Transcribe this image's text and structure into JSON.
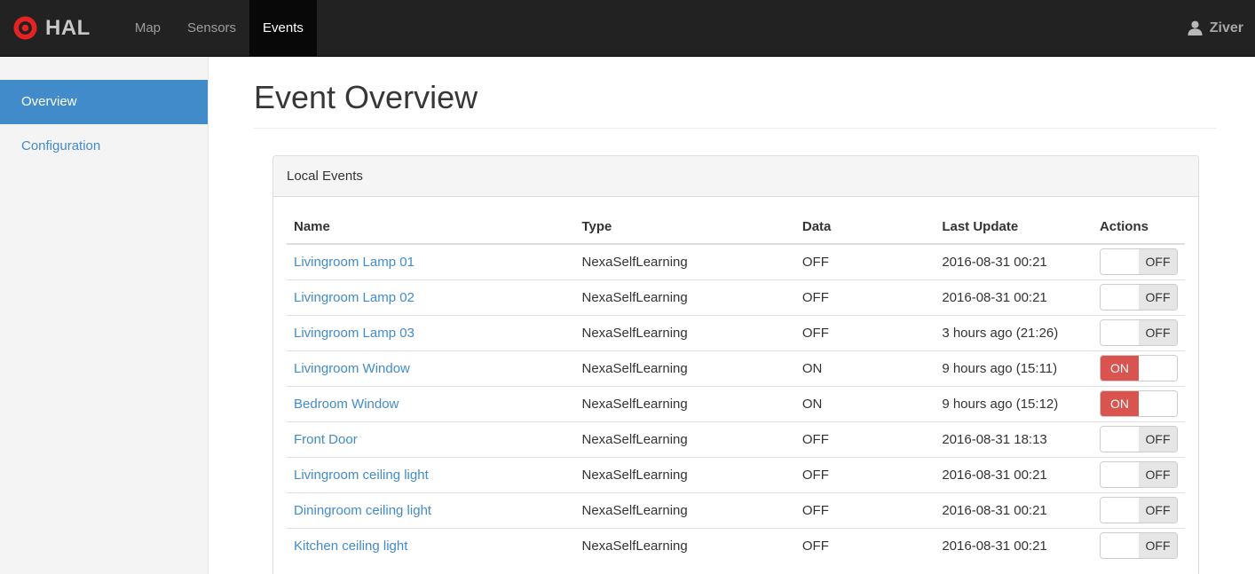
{
  "navbar": {
    "brand": "HAL",
    "items": [
      {
        "label": "Map",
        "active": false
      },
      {
        "label": "Sensors",
        "active": false
      },
      {
        "label": "Events",
        "active": true
      }
    ],
    "user": "Ziver"
  },
  "sidebar": {
    "items": [
      {
        "label": "Overview",
        "active": true
      },
      {
        "label": "Configuration",
        "active": false
      }
    ]
  },
  "page": {
    "title": "Event Overview"
  },
  "panel": {
    "title": "Local Events"
  },
  "toggle": {
    "on_label": "ON",
    "off_label": "OFF"
  },
  "table": {
    "columns": [
      "Name",
      "Type",
      "Data",
      "Last Update",
      "Actions"
    ],
    "rows": [
      {
        "name": "Livingroom Lamp 01",
        "type": "NexaSelfLearning",
        "data": "OFF",
        "last_update": "2016-08-31 00:21",
        "state": "OFF"
      },
      {
        "name": "Livingroom Lamp 02",
        "type": "NexaSelfLearning",
        "data": "OFF",
        "last_update": "2016-08-31 00:21",
        "state": "OFF"
      },
      {
        "name": "Livingroom Lamp 03",
        "type": "NexaSelfLearning",
        "data": "OFF",
        "last_update": "3 hours ago (21:26)",
        "state": "OFF"
      },
      {
        "name": "Livingroom Window",
        "type": "NexaSelfLearning",
        "data": "ON",
        "last_update": "9 hours ago (15:11)",
        "state": "ON"
      },
      {
        "name": "Bedroom Window",
        "type": "NexaSelfLearning",
        "data": "ON",
        "last_update": "9 hours ago (15:12)",
        "state": "ON"
      },
      {
        "name": "Front Door",
        "type": "NexaSelfLearning",
        "data": "OFF",
        "last_update": "2016-08-31 18:13",
        "state": "OFF"
      },
      {
        "name": "Livingroom ceiling light",
        "type": "NexaSelfLearning",
        "data": "OFF",
        "last_update": "2016-08-31 00:21",
        "state": "OFF"
      },
      {
        "name": "Diningroom ceiling light",
        "type": "NexaSelfLearning",
        "data": "OFF",
        "last_update": "2016-08-31 00:21",
        "state": "OFF"
      },
      {
        "name": "Kitchen ceiling light",
        "type": "NexaSelfLearning",
        "data": "OFF",
        "last_update": "2016-08-31 00:21",
        "state": "OFF"
      }
    ]
  },
  "colors": {
    "navbar_bg": "#222222",
    "navbar_active_bg": "#080808",
    "accent_blue": "#428bca",
    "toggle_on_red": "#d9534f",
    "toggle_off_gray": "#e6e6e6",
    "logo_red": "#e62222",
    "sidebar_bg": "#f4f4f4"
  }
}
